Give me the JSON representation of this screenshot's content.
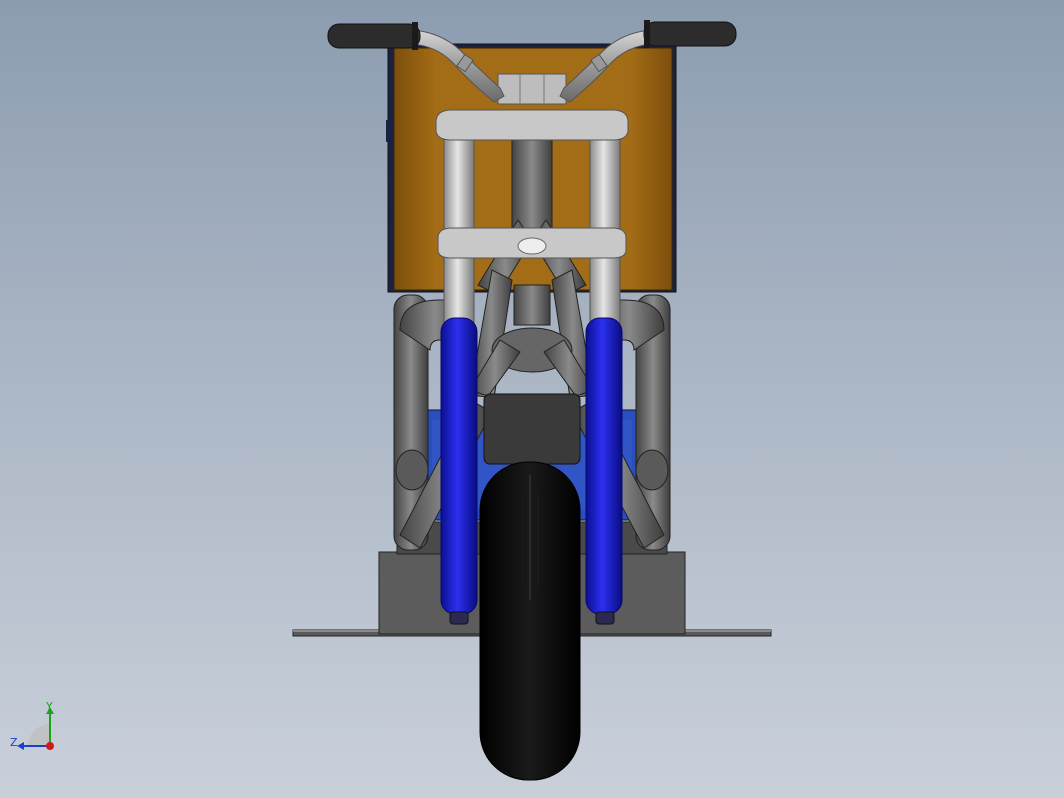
{
  "viewport": {
    "background_top": "#8c9cb0",
    "background_bottom": "#c9d0da"
  },
  "model": {
    "colors": {
      "fuel_tank": "#9a6514",
      "fork_lower": "#1c1fd0",
      "fork_upper": "#c4c4c4",
      "frame_tube": "#666666",
      "tire": "#050505",
      "grip": "#2c2c2c",
      "footpeg_plate": "#6a6a6a",
      "battery": "#2a4ec0"
    }
  },
  "triad": {
    "y_label": "Y",
    "z_label": "Z",
    "y_color": "#1aa31a",
    "z_color": "#1a3fd0",
    "origin_color": "#d01a1a"
  }
}
